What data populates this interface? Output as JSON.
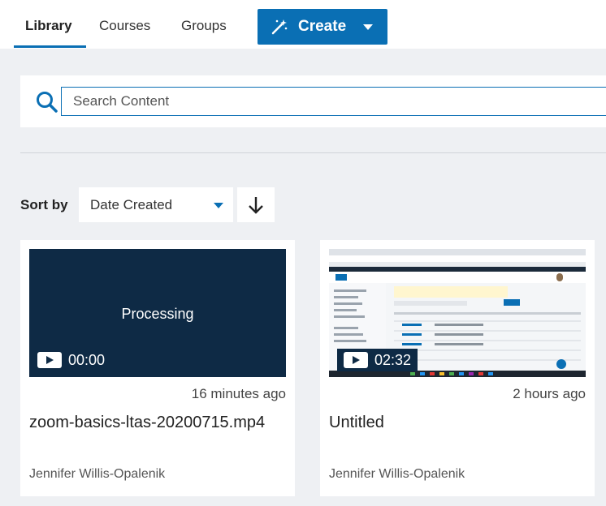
{
  "nav": {
    "tabs": [
      {
        "label": "Library",
        "active": true
      },
      {
        "label": "Courses",
        "active": false
      },
      {
        "label": "Groups",
        "active": false
      }
    ],
    "create_label": "Create"
  },
  "search": {
    "placeholder": "Search Content",
    "value": ""
  },
  "sort": {
    "label": "Sort by",
    "selected": "Date Created",
    "direction": "descending"
  },
  "cards": [
    {
      "status": "Processing",
      "duration": "00:00",
      "time_ago": "16 minutes ago",
      "title": "zoom-basics-ltas-20200715.mp4",
      "owner": "Jennifer Willis-Opalenik"
    },
    {
      "status": "",
      "duration": "02:32",
      "time_ago": "2 hours ago",
      "title": "Untitled",
      "owner": "Jennifer Willis-Opalenik"
    }
  ],
  "colors": {
    "accent": "#0a6fb4",
    "thumb_bg": "#0e2a45",
    "page_bg": "#eef0f3"
  },
  "icons": {
    "create": "magic-wand-icon",
    "search": "search-icon",
    "sort_direction": "arrow-down-icon",
    "play": "play-icon"
  }
}
